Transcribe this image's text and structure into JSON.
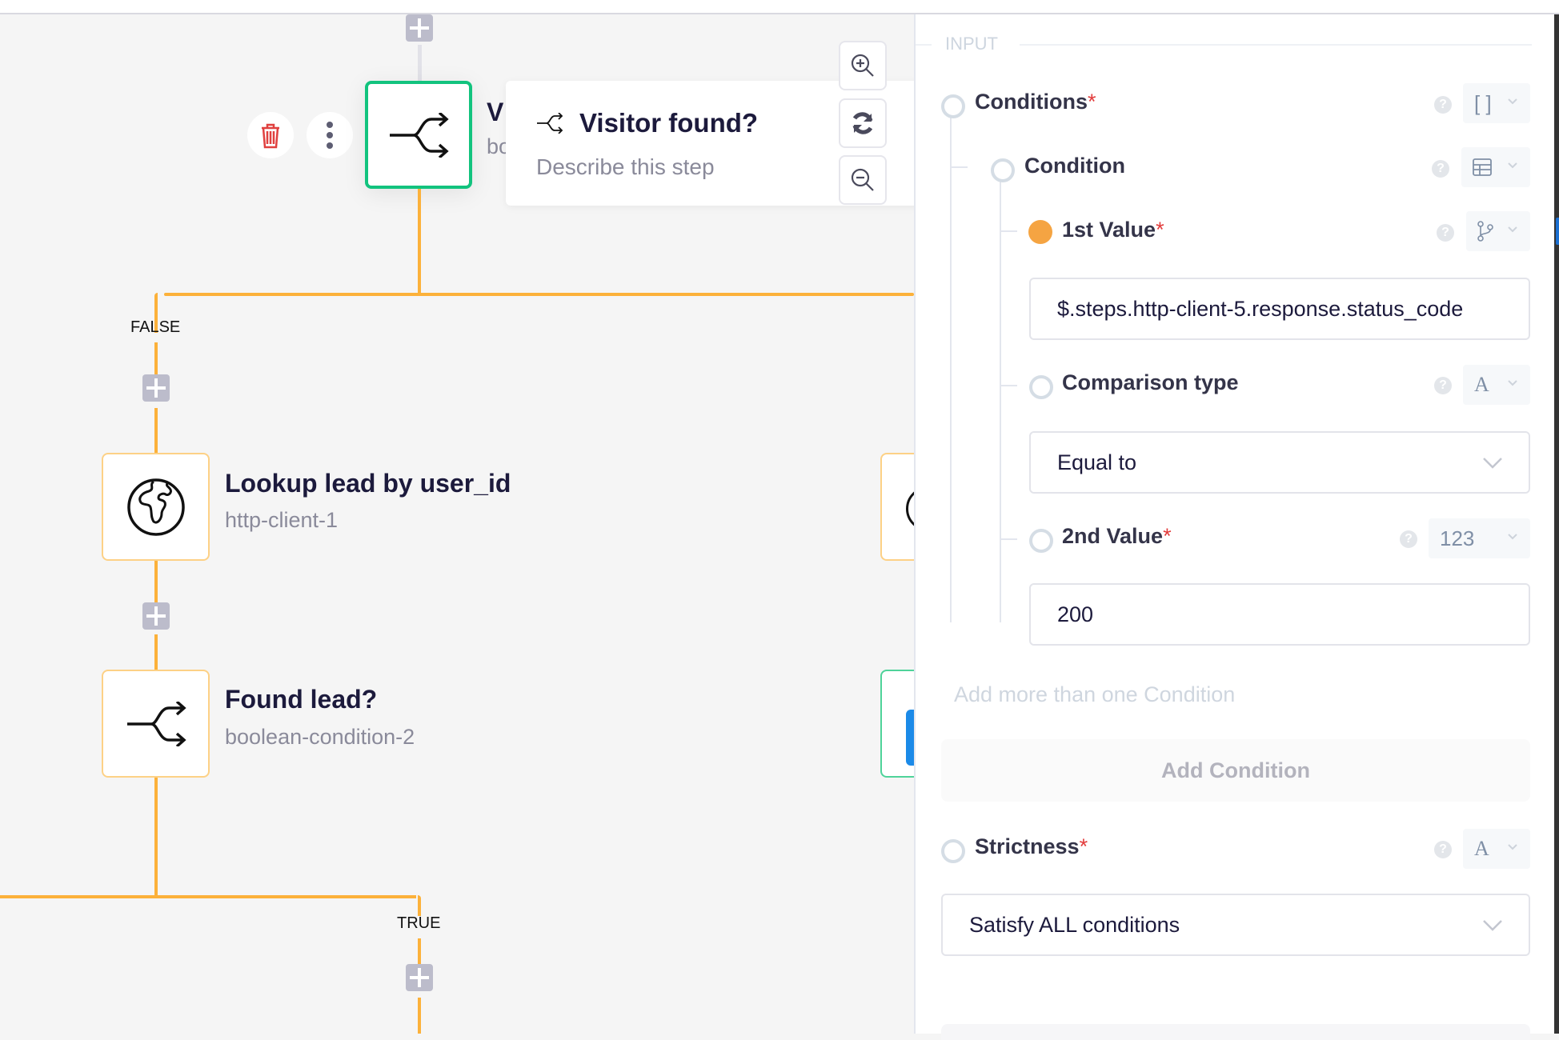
{
  "canvas": {
    "selected_node": {
      "title": "Visitor found?",
      "subtitle_partial": "bo",
      "title_partial": "V"
    },
    "branches": {
      "false_label": "FALSE",
      "true_label": "TRUE"
    },
    "nodes": [
      {
        "title": "Lookup lead by user_id",
        "subtitle": "http-client-1",
        "icon": "globe-icon"
      },
      {
        "title": "Found lead?",
        "subtitle": "boolean-condition-2",
        "icon": "branch-icon"
      }
    ],
    "step_card": {
      "title": "Visitor found?",
      "description_placeholder": "Describe this step"
    },
    "zoom_controls": [
      "zoom-in",
      "reset",
      "zoom-out"
    ],
    "colors": {
      "selected_border": "#12c37e",
      "connector": "#fcb13a",
      "node_border": "#fdd186",
      "delete": "#e0403f"
    }
  },
  "panel": {
    "section_label": "INPUT",
    "conditions": {
      "label": "Conditions",
      "required": "*",
      "type_icon": "[ ]"
    },
    "condition": {
      "label": "Condition",
      "type_icon": "table"
    },
    "first_value": {
      "label": "1st Value",
      "required": "*",
      "value": "$.steps.http-client-5.response.status_code"
    },
    "comparison": {
      "label": "Comparison type",
      "type_icon": "A",
      "selected": "Equal to"
    },
    "second_value": {
      "label": "2nd Value",
      "required": "*",
      "type_icon": "123",
      "value": "200"
    },
    "add_hint": "Add more than one Condition",
    "add_button": "Add Condition",
    "strictness": {
      "label": "Strictness",
      "required": "*",
      "type_icon": "A",
      "selected": "Satisfy ALL conditions"
    },
    "help_glyph": "?"
  }
}
